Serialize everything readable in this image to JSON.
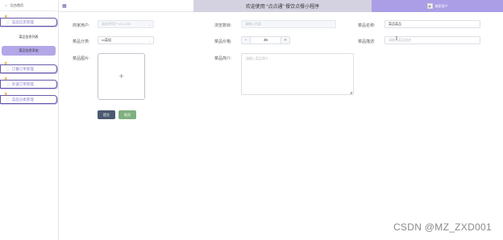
{
  "sidebar": {
    "header_title": "后台首页",
    "menu": [
      {
        "label": "菜品信息管理",
        "sub_items": [
          "菜品信息列表",
          "菜品信息添加"
        ]
      },
      {
        "label": "订餐订单管理"
      },
      {
        "label": "外送订单管理"
      },
      {
        "label": "菜品分类管理"
      }
    ],
    "active_sub": "菜品信息添加"
  },
  "header": {
    "title": "欢迎使用 “点点通” 餐饮点餐小程序",
    "user": "商家用户"
  },
  "form": {
    "merchant_label": "商家用户:",
    "merchant_value": "请选择用户 sfd 1232",
    "category_label": "菜品分类:",
    "category_value": "xx菜组",
    "image_label": "菜品图片:",
    "weight_label": "浏览数目:",
    "weight_placeholder": "请输入内容",
    "price_label": "菜品价格:",
    "price_value": "36",
    "intro_label": "菜品简介:",
    "intro_placeholder": "请输入菜品简介",
    "name_label": "菜品名称:",
    "name_value": "菜品菜品",
    "desc_label": "菜品描述:",
    "desc_placeholder": "请输入菜品描述",
    "submit_label": "提交",
    "cancel_label": "取消"
  },
  "watermark": "CSDN @MZ_ZXD001",
  "colors": {
    "accent": "#ab9ee6",
    "menu_text": "#8b7dd0",
    "submit": "#4a5a6f",
    "cancel": "#7fb07f"
  },
  "icons": [
    "menu-icon",
    "user-icon",
    "crown-icon",
    "document-icon",
    "avatar-icon",
    "plus-icon",
    "chevron-down-icon",
    "text-cursor-icon"
  ]
}
